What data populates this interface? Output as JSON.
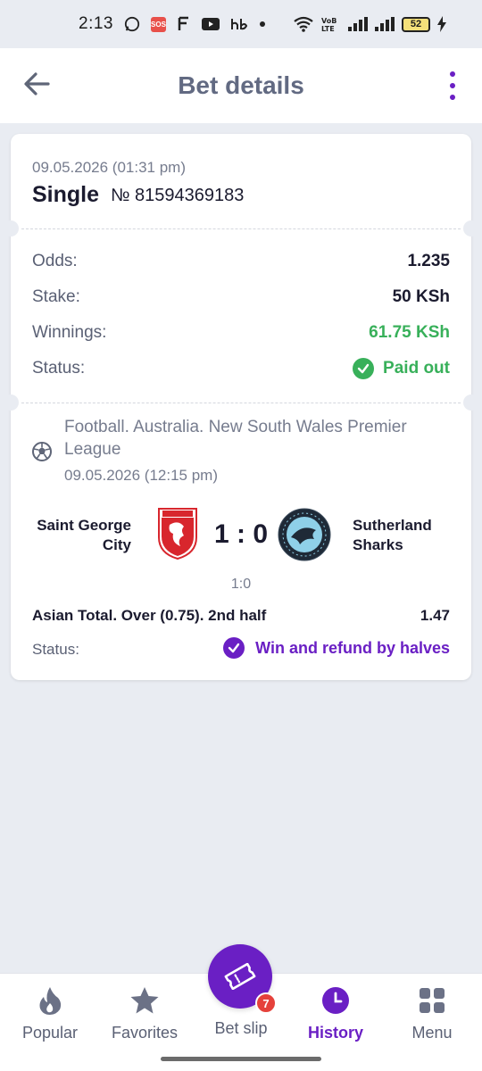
{
  "status_bar": {
    "time": "2:13",
    "sos": "SOS",
    "network": "VoB LTE",
    "battery": "52"
  },
  "header": {
    "title": "Bet details"
  },
  "bet": {
    "date": "09.05.2026 (01:31 pm)",
    "type": "Single",
    "number": "№ 81594369183",
    "odds_label": "Odds:",
    "odds_value": "1.235",
    "stake_label": "Stake:",
    "stake_value": "50 KSh",
    "winnings_label": "Winnings:",
    "winnings_value": "61.75 KSh",
    "status_label": "Status:",
    "status_value": "Paid out"
  },
  "event": {
    "league": "Football. Australia. New South Wales Premier League",
    "date": "09.05.2026 (12:15 pm)",
    "home_team": "Saint George City",
    "away_team": "Sutherland Sharks",
    "score": "1 : 0",
    "half_score": "1:0",
    "market": "Asian Total. Over (0.75). 2nd half",
    "market_odds": "1.47",
    "status_label": "Status:",
    "status_value": "Win and refund by halves"
  },
  "nav": {
    "popular": "Popular",
    "favorites": "Favorites",
    "betslip": "Bet slip",
    "betslip_count": "7",
    "history": "History",
    "menu": "Menu"
  },
  "colors": {
    "accent": "#6a1fc4",
    "success": "#38b05a",
    "badge": "#e5413b"
  }
}
